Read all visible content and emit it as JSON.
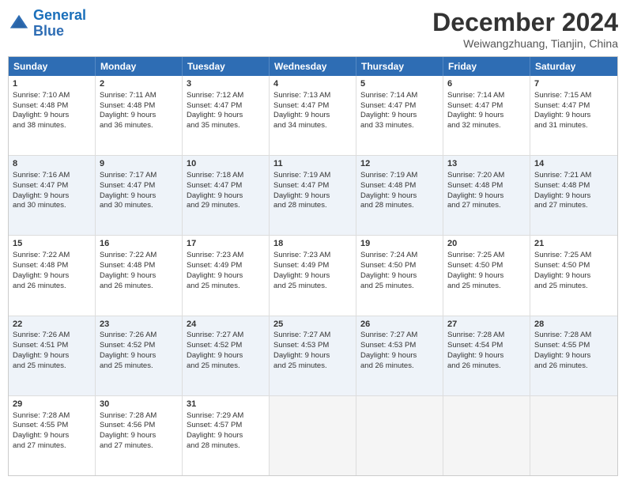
{
  "logo": {
    "line1": "General",
    "line2": "Blue"
  },
  "title": "December 2024",
  "subtitle": "Weiwangzhuang, Tianjin, China",
  "days": [
    "Sunday",
    "Monday",
    "Tuesday",
    "Wednesday",
    "Thursday",
    "Friday",
    "Saturday"
  ],
  "rows": [
    [
      {
        "day": "1",
        "info": "Sunrise: 7:10 AM\nSunset: 4:48 PM\nDaylight: 9 hours\nand 38 minutes.",
        "empty": false
      },
      {
        "day": "2",
        "info": "Sunrise: 7:11 AM\nSunset: 4:48 PM\nDaylight: 9 hours\nand 36 minutes.",
        "empty": false
      },
      {
        "day": "3",
        "info": "Sunrise: 7:12 AM\nSunset: 4:47 PM\nDaylight: 9 hours\nand 35 minutes.",
        "empty": false
      },
      {
        "day": "4",
        "info": "Sunrise: 7:13 AM\nSunset: 4:47 PM\nDaylight: 9 hours\nand 34 minutes.",
        "empty": false
      },
      {
        "day": "5",
        "info": "Sunrise: 7:14 AM\nSunset: 4:47 PM\nDaylight: 9 hours\nand 33 minutes.",
        "empty": false
      },
      {
        "day": "6",
        "info": "Sunrise: 7:14 AM\nSunset: 4:47 PM\nDaylight: 9 hours\nand 32 minutes.",
        "empty": false
      },
      {
        "day": "7",
        "info": "Sunrise: 7:15 AM\nSunset: 4:47 PM\nDaylight: 9 hours\nand 31 minutes.",
        "empty": false
      }
    ],
    [
      {
        "day": "8",
        "info": "Sunrise: 7:16 AM\nSunset: 4:47 PM\nDaylight: 9 hours\nand 30 minutes.",
        "empty": false
      },
      {
        "day": "9",
        "info": "Sunrise: 7:17 AM\nSunset: 4:47 PM\nDaylight: 9 hours\nand 30 minutes.",
        "empty": false
      },
      {
        "day": "10",
        "info": "Sunrise: 7:18 AM\nSunset: 4:47 PM\nDaylight: 9 hours\nand 29 minutes.",
        "empty": false
      },
      {
        "day": "11",
        "info": "Sunrise: 7:19 AM\nSunset: 4:47 PM\nDaylight: 9 hours\nand 28 minutes.",
        "empty": false
      },
      {
        "day": "12",
        "info": "Sunrise: 7:19 AM\nSunset: 4:48 PM\nDaylight: 9 hours\nand 28 minutes.",
        "empty": false
      },
      {
        "day": "13",
        "info": "Sunrise: 7:20 AM\nSunset: 4:48 PM\nDaylight: 9 hours\nand 27 minutes.",
        "empty": false
      },
      {
        "day": "14",
        "info": "Sunrise: 7:21 AM\nSunset: 4:48 PM\nDaylight: 9 hours\nand 27 minutes.",
        "empty": false
      }
    ],
    [
      {
        "day": "15",
        "info": "Sunrise: 7:22 AM\nSunset: 4:48 PM\nDaylight: 9 hours\nand 26 minutes.",
        "empty": false
      },
      {
        "day": "16",
        "info": "Sunrise: 7:22 AM\nSunset: 4:48 PM\nDaylight: 9 hours\nand 26 minutes.",
        "empty": false
      },
      {
        "day": "17",
        "info": "Sunrise: 7:23 AM\nSunset: 4:49 PM\nDaylight: 9 hours\nand 25 minutes.",
        "empty": false
      },
      {
        "day": "18",
        "info": "Sunrise: 7:23 AM\nSunset: 4:49 PM\nDaylight: 9 hours\nand 25 minutes.",
        "empty": false
      },
      {
        "day": "19",
        "info": "Sunrise: 7:24 AM\nSunset: 4:50 PM\nDaylight: 9 hours\nand 25 minutes.",
        "empty": false
      },
      {
        "day": "20",
        "info": "Sunrise: 7:25 AM\nSunset: 4:50 PM\nDaylight: 9 hours\nand 25 minutes.",
        "empty": false
      },
      {
        "day": "21",
        "info": "Sunrise: 7:25 AM\nSunset: 4:50 PM\nDaylight: 9 hours\nand 25 minutes.",
        "empty": false
      }
    ],
    [
      {
        "day": "22",
        "info": "Sunrise: 7:26 AM\nSunset: 4:51 PM\nDaylight: 9 hours\nand 25 minutes.",
        "empty": false
      },
      {
        "day": "23",
        "info": "Sunrise: 7:26 AM\nSunset: 4:52 PM\nDaylight: 9 hours\nand 25 minutes.",
        "empty": false
      },
      {
        "day": "24",
        "info": "Sunrise: 7:27 AM\nSunset: 4:52 PM\nDaylight: 9 hours\nand 25 minutes.",
        "empty": false
      },
      {
        "day": "25",
        "info": "Sunrise: 7:27 AM\nSunset: 4:53 PM\nDaylight: 9 hours\nand 25 minutes.",
        "empty": false
      },
      {
        "day": "26",
        "info": "Sunrise: 7:27 AM\nSunset: 4:53 PM\nDaylight: 9 hours\nand 26 minutes.",
        "empty": false
      },
      {
        "day": "27",
        "info": "Sunrise: 7:28 AM\nSunset: 4:54 PM\nDaylight: 9 hours\nand 26 minutes.",
        "empty": false
      },
      {
        "day": "28",
        "info": "Sunrise: 7:28 AM\nSunset: 4:55 PM\nDaylight: 9 hours\nand 26 minutes.",
        "empty": false
      }
    ],
    [
      {
        "day": "29",
        "info": "Sunrise: 7:28 AM\nSunset: 4:55 PM\nDaylight: 9 hours\nand 27 minutes.",
        "empty": false
      },
      {
        "day": "30",
        "info": "Sunrise: 7:28 AM\nSunset: 4:56 PM\nDaylight: 9 hours\nand 27 minutes.",
        "empty": false
      },
      {
        "day": "31",
        "info": "Sunrise: 7:29 AM\nSunset: 4:57 PM\nDaylight: 9 hours\nand 28 minutes.",
        "empty": false
      },
      {
        "day": "",
        "info": "",
        "empty": true
      },
      {
        "day": "",
        "info": "",
        "empty": true
      },
      {
        "day": "",
        "info": "",
        "empty": true
      },
      {
        "day": "",
        "info": "",
        "empty": true
      }
    ]
  ]
}
